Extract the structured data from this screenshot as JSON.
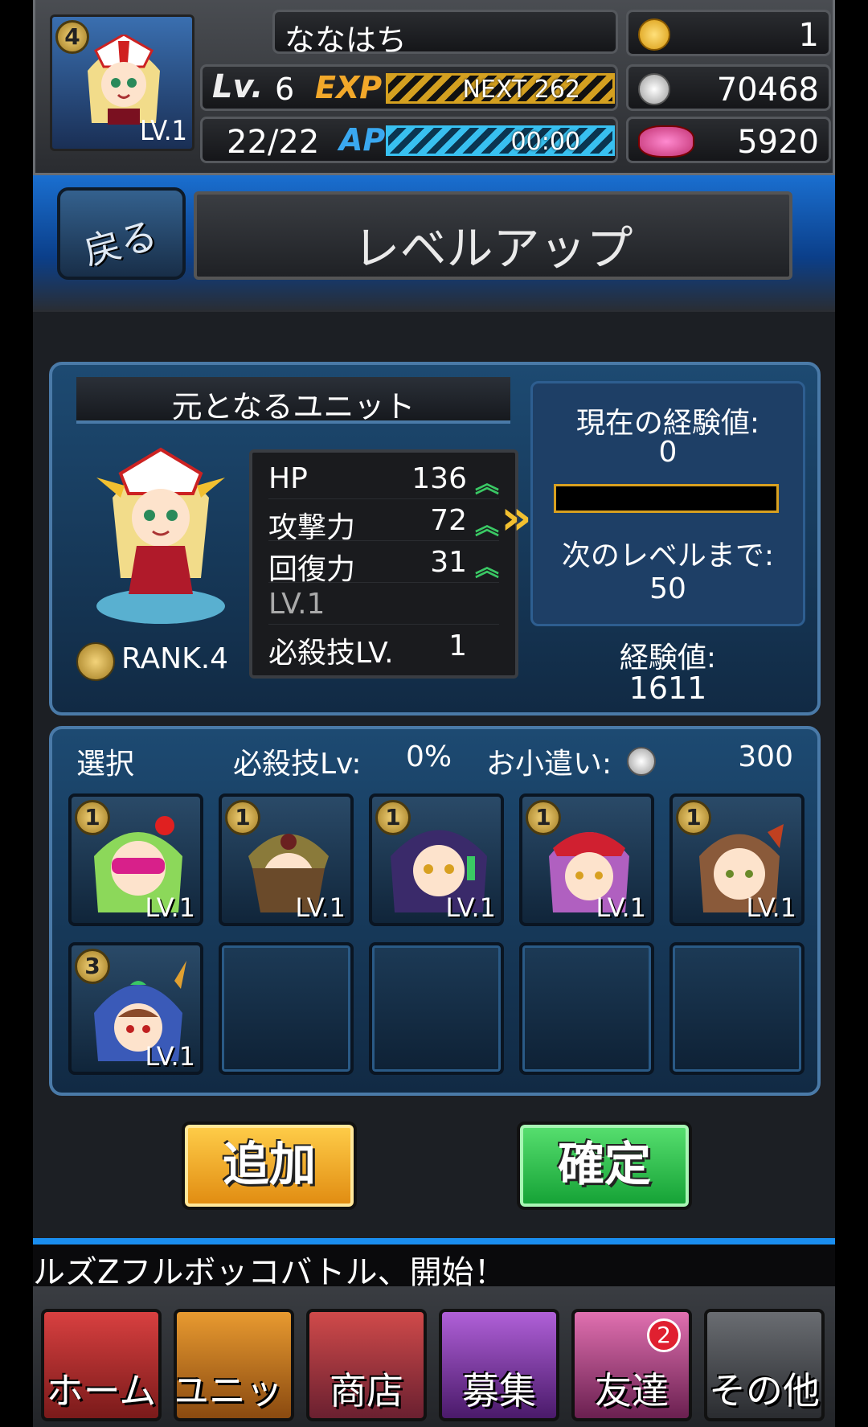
{
  "player": {
    "name": "ななはち",
    "avatar_badge": "4",
    "avatar_lv": "LV.1",
    "lv_label": "Lv.",
    "level": "6",
    "exp_label": "EXP",
    "exp_next": "NEXT 262",
    "ap_value": "22/22",
    "ap_label": "AP",
    "ap_timer": "00:00"
  },
  "currency": {
    "gold": "1",
    "silver": "70468",
    "friend_points": "5920"
  },
  "header": {
    "back_label": "戻る",
    "title": "レベルアップ"
  },
  "base_unit": {
    "section_title": "元となるユニット",
    "rank": "RANK.4",
    "stats": [
      {
        "label": "HP",
        "value": "136"
      },
      {
        "label": "攻撃力",
        "value": "72"
      },
      {
        "label": "回復力",
        "value": "31"
      },
      {
        "label": "LV.1",
        "value": ""
      },
      {
        "label": "必殺技LV.",
        "value": "1"
      }
    ],
    "current_exp_label": "現在の経験値:",
    "current_exp": "0",
    "current_exp_fill": 0,
    "next_level_label": "次のレベルまで:",
    "next_level": "50",
    "exp_total_label": "経験値:",
    "exp_total": "1611"
  },
  "materials": {
    "select_label": "選択",
    "skill_label": "必殺技Lv:",
    "skill_value": "0%",
    "cost_label": "お小遣い:",
    "cost_value": "300",
    "units": [
      {
        "badge": "1",
        "lv": "LV.1"
      },
      {
        "badge": "1",
        "lv": "LV.1"
      },
      {
        "badge": "1",
        "lv": "LV.1"
      },
      {
        "badge": "1",
        "lv": "LV.1"
      },
      {
        "badge": "1",
        "lv": "LV.1"
      },
      {
        "badge": "3",
        "lv": "LV.1"
      }
    ]
  },
  "buttons": {
    "add": "追加",
    "confirm": "確定"
  },
  "ticker": "ルズZフルボッコバトル、開始！",
  "nav": {
    "home": "ホーム",
    "unit": "ユニット",
    "shop": "商店",
    "recruit": "募集",
    "friends": "友達",
    "friends_badge": "2",
    "other": "その他"
  }
}
